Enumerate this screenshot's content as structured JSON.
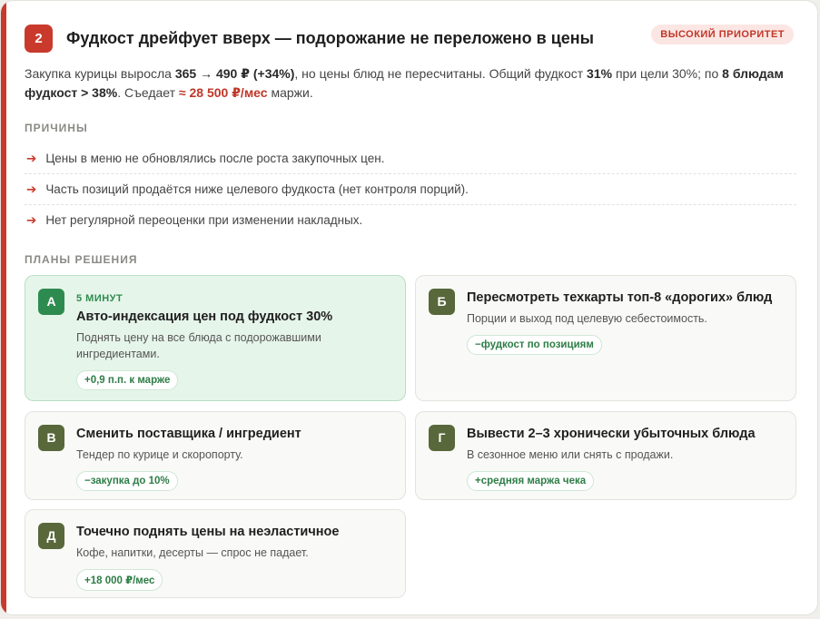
{
  "issue": {
    "number": "2",
    "title": "Фудкост дрейфует вверх — подорожание не переложено в цены",
    "priority": "ВЫСОКИЙ ПРИОРИТЕТ"
  },
  "summary": {
    "p1": "Закупка курицы выросла ",
    "b1": "365 → 490 ₽ (+34%)",
    "p2": ", но цены блюд не пересчитаны. Общий фудкост ",
    "b2": "31%",
    "p3": " при цели 30%; по ",
    "b3": "8 блюдам фудкост > 38%",
    "p4": ". Съедает ",
    "red": "≈ 28 500 ₽/мес",
    "p5": " маржи."
  },
  "causes": {
    "label": "ПРИЧИНЫ",
    "items": [
      "Цены в меню не обновлялись после роста закупочных цен.",
      "Часть позиций продаётся ниже целевого фудкоста (нет контроля порций).",
      "Нет регулярной переоценки при изменении накладных."
    ]
  },
  "plans": {
    "label": "ПЛАНЫ РЕШЕНИЯ",
    "items": [
      {
        "letter": "А",
        "tag": "5 МИНУТ",
        "title": "Авто-индексация цен под фудкост 30%",
        "desc": "Поднять цену на все блюда с подорожавшими ингредиентами.",
        "pill": "+0,9 п.п. к марже"
      },
      {
        "letter": "Б",
        "tag": "",
        "title": "Пересмотреть техкарты топ-8 «дорогих» блюд",
        "desc": "Порции и выход под целевую себестоимость.",
        "pill": "−фудкост по позициям"
      },
      {
        "letter": "В",
        "tag": "",
        "title": "Сменить поставщика / ингредиент",
        "desc": "Тендер по курице и скоропорту.",
        "pill": "−закупка до 10%"
      },
      {
        "letter": "Г",
        "tag": "",
        "title": "Вывести 2–3 хронически убыточных блюда",
        "desc": "В сезонное меню или снять с продажи.",
        "pill": "+средняя маржа чека"
      },
      {
        "letter": "Д",
        "tag": "",
        "title": "Точечно поднять цены на неэластичное",
        "desc": "Кофе, напитки, десерты — спрос не падает.",
        "pill": "+18 000 ₽/мес"
      }
    ]
  },
  "colors": {
    "accent": "#c93a2c",
    "success": "#2e8b4f",
    "plan_letter": "#58683a"
  }
}
